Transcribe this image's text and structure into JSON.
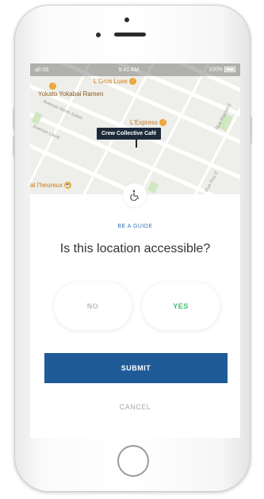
{
  "status_bar": {
    "carrier": "all 0S",
    "time": "9:41 AM",
    "battery": "100%"
  },
  "map": {
    "pois": [
      {
        "label": "L'Gros Luxe",
        "icon": "restaurant-icon"
      },
      {
        "label": "Yokato Yokabai Ramen",
        "icon": "restaurant-icon"
      },
      {
        "label": "L'Express",
        "icon": "restaurant-icon"
      },
      {
        "label": "at l'heureux",
        "icon": "cafe-icon"
      }
    ],
    "streets": [
      "Avenue Henri-Julien",
      "Avenue Laval",
      "Rue Rachel E",
      "Rue Roy E"
    ],
    "selected_place": "Crew Collective Café"
  },
  "sheet": {
    "icon": "wheelchair-icon",
    "eyebrow": "BE A GUIDE",
    "question": "Is this location accessible?",
    "no_label": "NO",
    "yes_label": "YES",
    "submit_label": "SUBMIT",
    "cancel_label": "CANCEL"
  },
  "colors": {
    "accent": "#2f74b5",
    "submit_bg": "#1f5b96",
    "yes": "#3cc26b",
    "poi": "#f0a52c"
  }
}
